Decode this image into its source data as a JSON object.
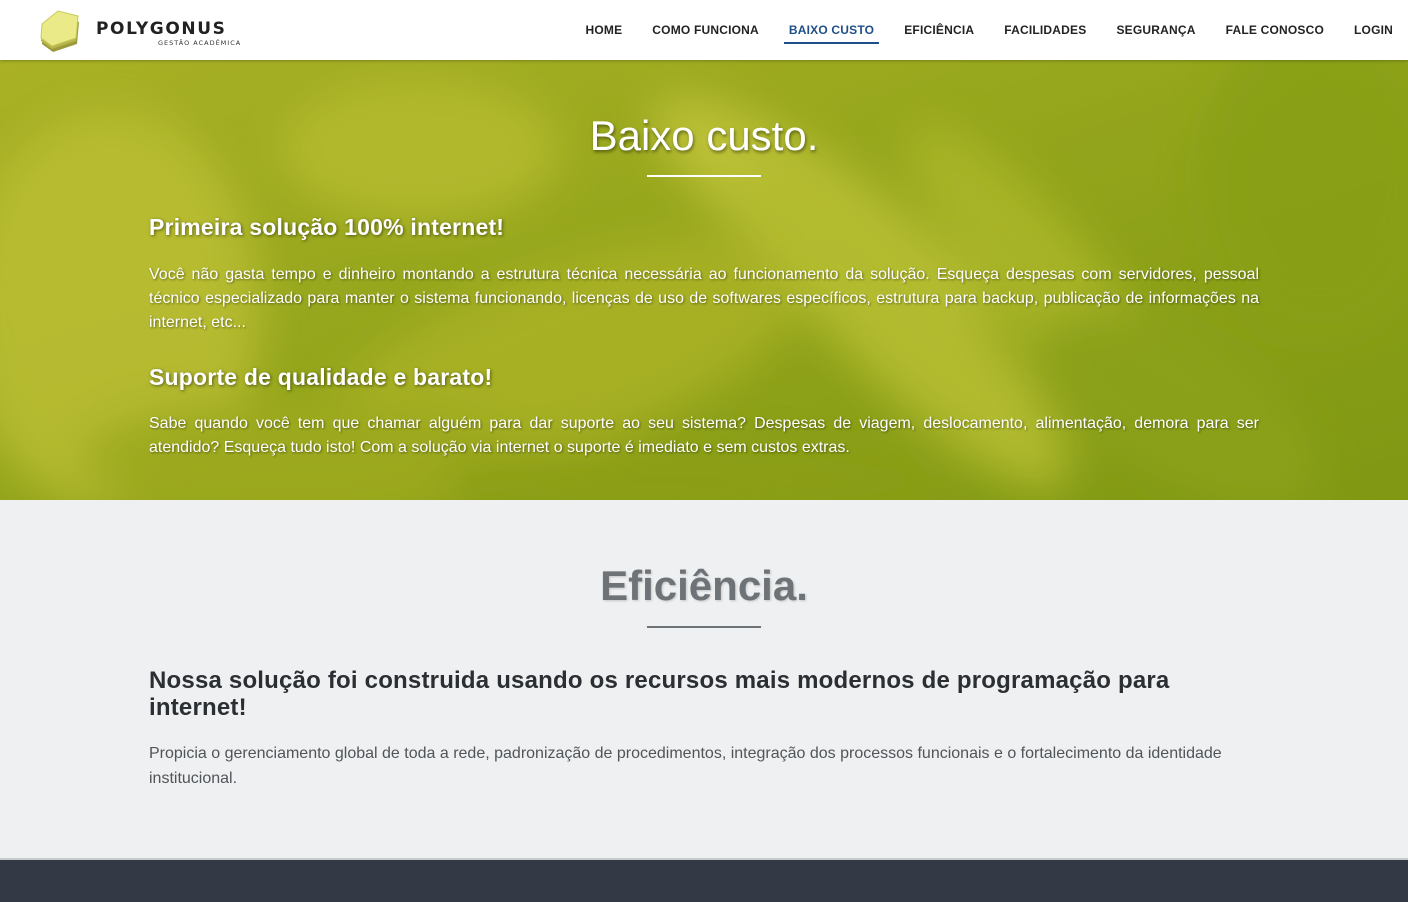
{
  "brand": {
    "name": "POLYGONUS",
    "tagline": "Gestão Acadêmica"
  },
  "nav": {
    "items": [
      {
        "label": "HOME"
      },
      {
        "label": "COMO FUNCIONA"
      },
      {
        "label": "BAIXO CUSTO"
      },
      {
        "label": "EFICIÊNCIA"
      },
      {
        "label": "FACILIDADES"
      },
      {
        "label": "SEGURANÇA"
      },
      {
        "label": "FALE CONOSCO"
      },
      {
        "label": "LOGIN"
      }
    ],
    "active_index": 2,
    "active_color": "#1f4f86"
  },
  "hero": {
    "title": "Baixo custo.",
    "blocks": [
      {
        "heading": "Primeira solução 100% internet!",
        "text": "Você não gasta tempo e dinheiro montando a estrutura técnica necessária ao funcionamento da solução. Esqueça despesas com servidores, pessoal técnico especializado para manter o sistema funcionando, licenças de uso de softwares específicos, estrutura para backup, publicação de informações na internet, etc..."
      },
      {
        "heading": "Suporte de qualidade e barato!",
        "text": "Sabe quando você tem que chamar alguém para dar suporte ao seu sistema? Despesas de viagem, deslocamento, alimentação, demora para ser atendido? Esqueça tudo isto! Com a solução via internet o suporte é imediato e sem custos extras."
      }
    ],
    "bg_color": "#93a41b"
  },
  "eficiencia": {
    "title": "Eficiência.",
    "heading": "Nossa solução foi construida usando os recursos mais modernos de programação para internet!",
    "text": "Propicia o gerenciamento global de toda a rede, padronização de procedimentos, integração dos processos funcionais e o fortalecimento da identidade institucional."
  },
  "colors": {
    "footer": "#333945",
    "section_bg": "#eff0f1"
  }
}
